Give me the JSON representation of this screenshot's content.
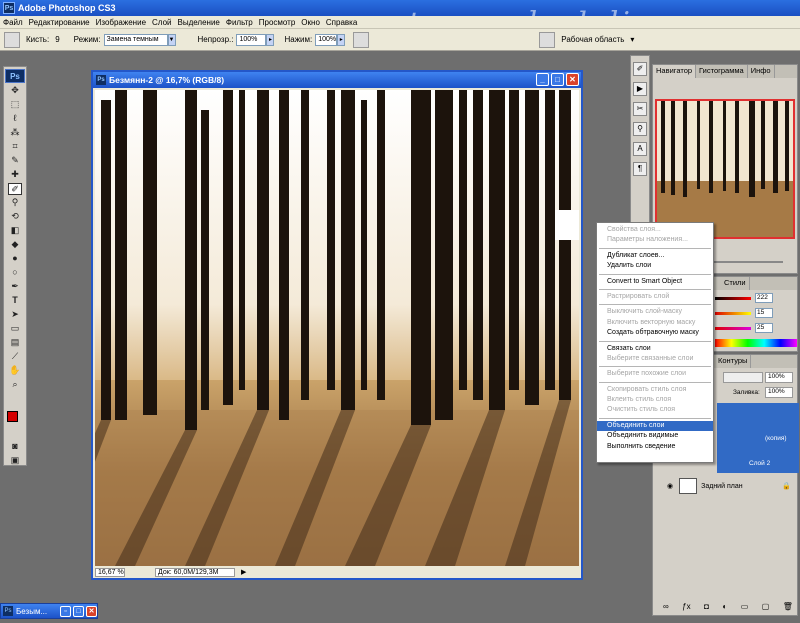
{
  "app": {
    "title": "Adobe Photoshop CS3",
    "watermark": "mastera-rukodeliya.ru"
  },
  "menu": [
    "Файл",
    "Редактирование",
    "Изображение",
    "Слой",
    "Выделение",
    "Фильтр",
    "Просмотр",
    "Окно",
    "Справка"
  ],
  "options_bar": {
    "brush_label": "Кисть:",
    "brush_size": "9",
    "mode_label": "Режим:",
    "mode_value": "Замена темным",
    "opacity_label": "Непрозр.:",
    "opacity_value": "100%",
    "flow_label": "Нажим:",
    "flow_value": "100%",
    "workspace_label": "Рабочая область"
  },
  "document": {
    "title": "Безмянн-2 @ 16,7% (RGB/8)",
    "zoom": "16,67 %",
    "doc_size": "Док: 60,0M/129,3M"
  },
  "panels": {
    "navigator_tabs": [
      "Навигатор",
      "Гистограмма",
      "Инфо"
    ],
    "color_tab": "Стили",
    "color_values": [
      "222",
      "15",
      "25"
    ],
    "layers_tab": "Контуры",
    "opacity_value": "100%",
    "fill_label": "Заливка:",
    "fill_value": "100%",
    "layer_names": [
      "(копия)",
      "Слой 2",
      "Задний план"
    ]
  },
  "context_menu": {
    "items": [
      {
        "label": "Свойства слоя...",
        "disabled": true
      },
      {
        "label": "Параметры наложения...",
        "disabled": true
      },
      {
        "sep": true
      },
      {
        "label": "Дубликат слоев...",
        "disabled": false
      },
      {
        "label": "Удалить слои",
        "disabled": false
      },
      {
        "sep": true
      },
      {
        "label": "Convert to Smart Object",
        "disabled": false
      },
      {
        "sep": true
      },
      {
        "label": "Растрировать слой",
        "disabled": true
      },
      {
        "sep": true
      },
      {
        "label": "Выключить слой-маску",
        "disabled": true
      },
      {
        "label": "Включить векторную маску",
        "disabled": true
      },
      {
        "label": "Создать обтравочную маску",
        "disabled": false
      },
      {
        "sep": true
      },
      {
        "label": "Связать слои",
        "disabled": false
      },
      {
        "label": "Выберите связанные слои",
        "disabled": true
      },
      {
        "sep": true
      },
      {
        "label": "Выберите похожие слои",
        "disabled": true
      },
      {
        "sep": true
      },
      {
        "label": "Скопировать стиль слоя",
        "disabled": true
      },
      {
        "label": "Вклеить стиль слоя",
        "disabled": true
      },
      {
        "label": "Очистить стиль слоя",
        "disabled": true
      },
      {
        "sep": true
      },
      {
        "label": "Объединить слои",
        "disabled": false,
        "selected": true
      },
      {
        "label": "Объединить видимые",
        "disabled": false
      },
      {
        "label": "Выполнить сведение",
        "disabled": false
      }
    ]
  },
  "taskbar_doc": "Безым...",
  "colors": {
    "title_blue": "#1a4fc2",
    "chrome": "#ece9d8",
    "workspace": "#6e6e6e",
    "menu_highlight": "#316ac5",
    "foreground_swatch": "#d40000"
  }
}
